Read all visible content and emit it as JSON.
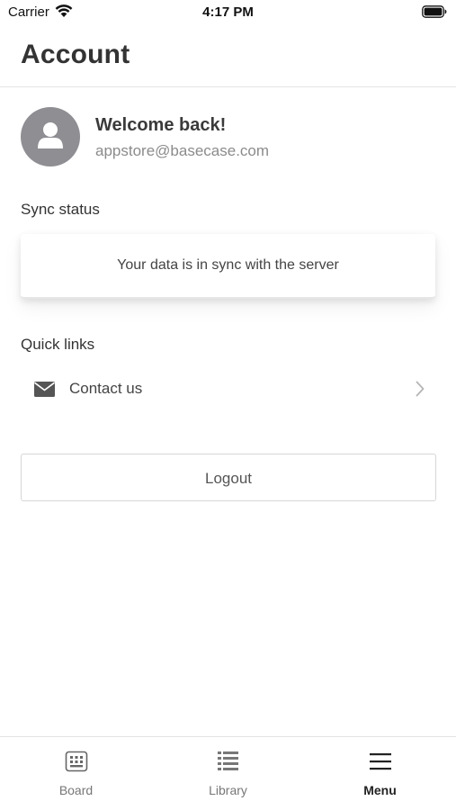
{
  "status_bar": {
    "carrier": "Carrier",
    "time": "4:17 PM"
  },
  "header": {
    "title": "Account"
  },
  "profile": {
    "greeting": "Welcome back!",
    "email": "appstore@basecase.com"
  },
  "sync": {
    "label": "Sync status",
    "message": "Your data is in sync with the server"
  },
  "quick_links": {
    "label": "Quick links",
    "items": [
      {
        "label": "Contact us",
        "icon": "mail-icon"
      }
    ]
  },
  "logout": {
    "label": "Logout"
  },
  "tab_bar": {
    "tabs": [
      {
        "label": "Board",
        "icon": "keypad-icon",
        "active": false
      },
      {
        "label": "Library",
        "icon": "list-icon",
        "active": false
      },
      {
        "label": "Menu",
        "icon": "hamburger-icon",
        "active": true
      }
    ]
  },
  "colors": {
    "avatar_bg": "#8e8e93",
    "text_primary": "#333333",
    "text_secondary": "#8b8b8b",
    "divider": "#e3e3e3"
  }
}
